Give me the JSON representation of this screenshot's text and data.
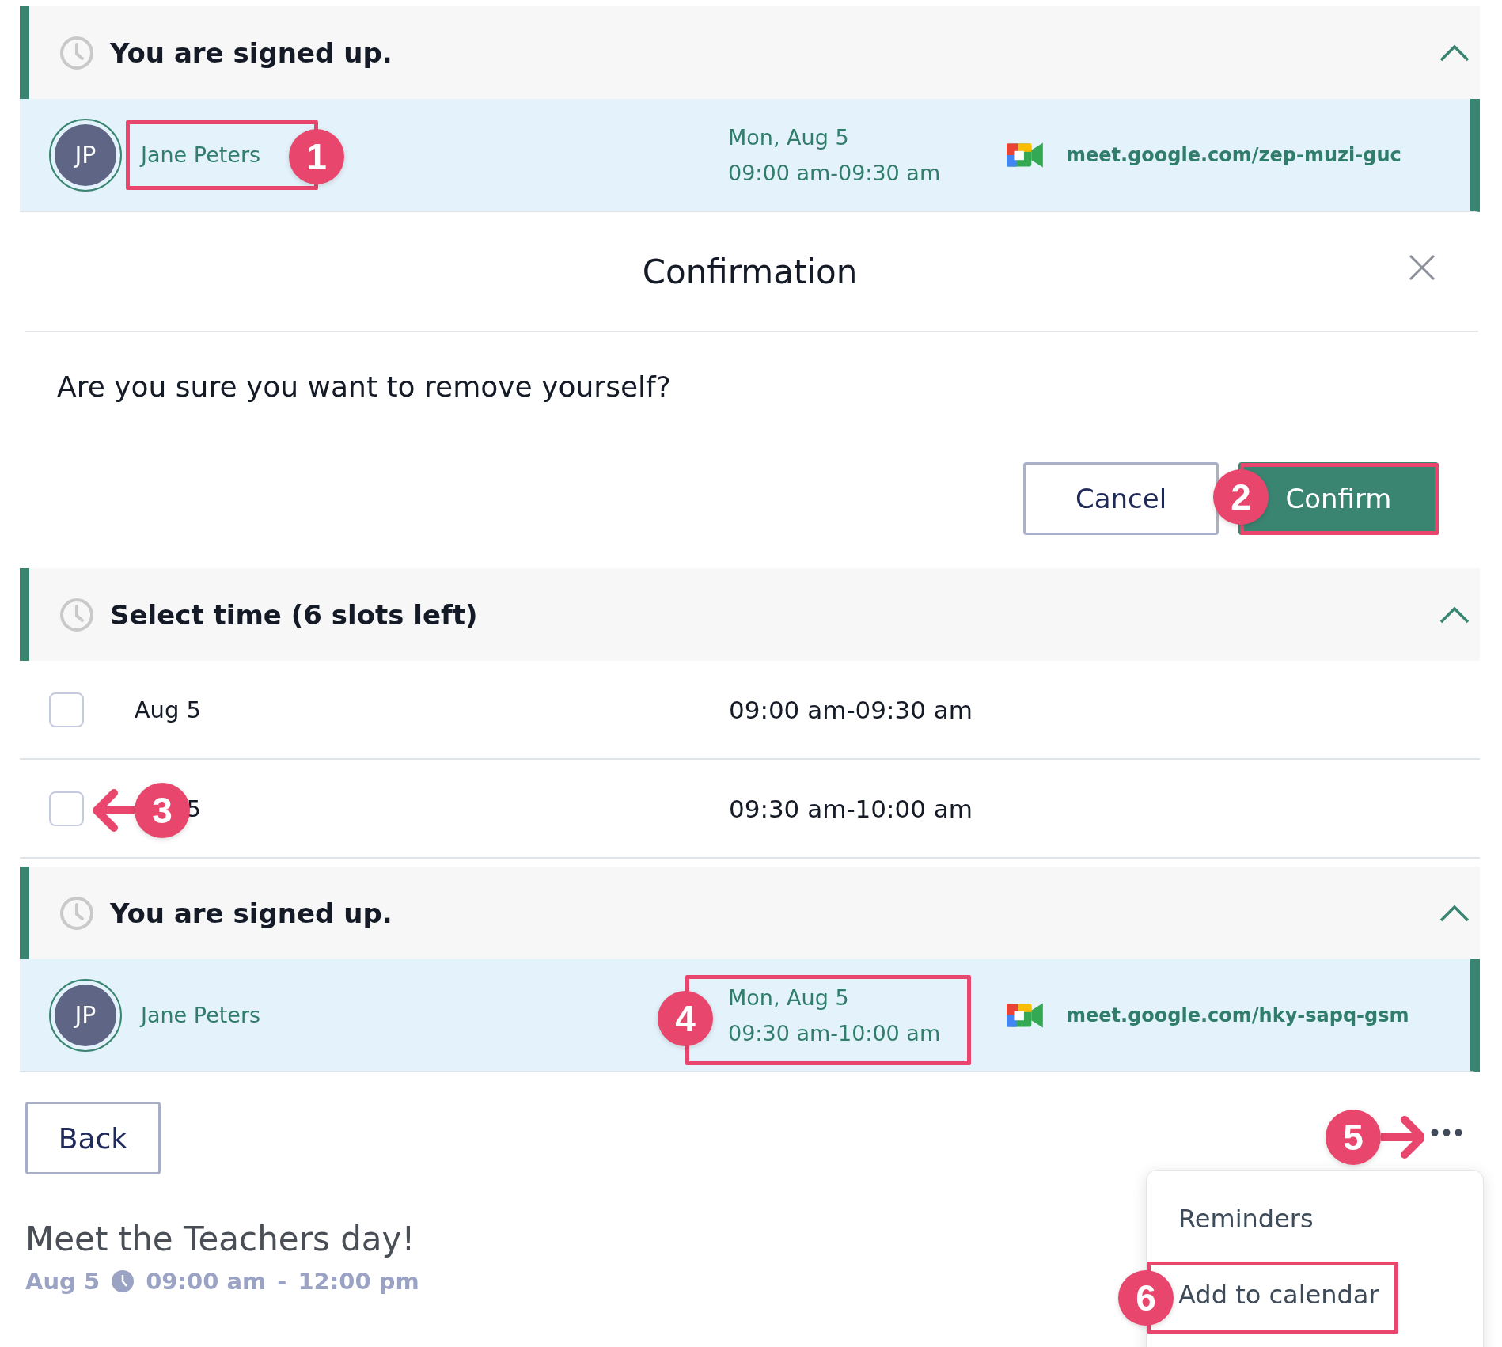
{
  "signup_top": {
    "title": "You are signed up.",
    "expanded": true,
    "entry": {
      "initials": "JP",
      "name": "Jane Peters",
      "date": "Mon, Aug 5",
      "time": "09:00 am-09:30 am",
      "link": "meet.google.com/zep-muzi-guc"
    }
  },
  "confirmation_dialog": {
    "title": "Confirmation",
    "message": "Are you sure you want to remove yourself?",
    "buttons": [
      {
        "label": "Cancel",
        "kind": "secondary"
      },
      {
        "label": "Confirm",
        "kind": "primary"
      }
    ]
  },
  "select_time": {
    "title": "Select time (6 slots left)",
    "expanded": true,
    "slots": [
      {
        "date": "Aug 5",
        "time": "09:00 am-09:30 am",
        "checked": false
      },
      {
        "date": "5",
        "time": "09:30 am-10:00 am",
        "checked": false
      }
    ]
  },
  "signup_bottom": {
    "title": "You are signed up.",
    "expanded": true,
    "entry": {
      "initials": "JP",
      "name": "Jane Peters",
      "date": "Mon, Aug 5",
      "time": "09:30 am-10:00 am",
      "link": "meet.google.com/hky-sapq-gsm"
    }
  },
  "back_button": "Back",
  "more_menu": {
    "open": true,
    "items": [
      "Reminders",
      "Add to calendar"
    ]
  },
  "event": {
    "title": "Meet the Teachers day!",
    "date": "Aug 5",
    "start": "09:00 am",
    "separator": "-",
    "end": "12:00 pm"
  },
  "annotations": [
    {
      "label": "1",
      "kind": "box"
    },
    {
      "label": "2",
      "kind": "box"
    },
    {
      "label": "3",
      "kind": "arrow_left"
    },
    {
      "label": "4",
      "kind": "box"
    },
    {
      "label": "5",
      "kind": "arrow_right"
    },
    {
      "label": "6",
      "kind": "box"
    }
  ]
}
